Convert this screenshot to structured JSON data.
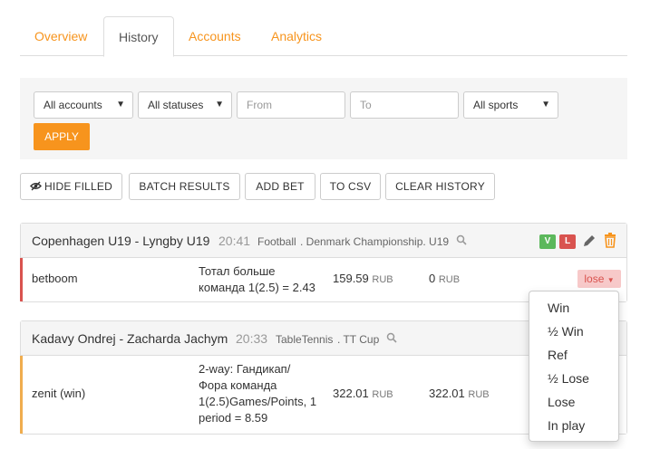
{
  "tabs": [
    {
      "label": "Overview"
    },
    {
      "label": "History"
    },
    {
      "label": "Accounts"
    },
    {
      "label": "Analytics"
    }
  ],
  "filters": {
    "accounts": "All accounts",
    "statuses": "All statuses",
    "from_placeholder": "From",
    "to_placeholder": "To",
    "sports": "All sports",
    "apply_label": "APPLY"
  },
  "toolbar": {
    "hide_filled": "HIDE FILLED",
    "batch_results": "BATCH RESULTS",
    "add_bet": "ADD BET",
    "to_csv": "TO CSV",
    "clear_history": "CLEAR HISTORY"
  },
  "bets": [
    {
      "match": "Copenhagen U19 - Lyngby U19",
      "time": "20:41",
      "sport": "Football",
      "league": ". Denmark Championship. U19",
      "badges": [
        "V",
        "L"
      ],
      "account": "betboom",
      "market_line1": "Тотал больше",
      "market_line2": "команда 1(2.5) = 2.43",
      "stake": "159.59",
      "stake_currency": "RUB",
      "payout": "0",
      "payout_currency": "RUB",
      "status": "lose",
      "row_color": "#d9534f"
    },
    {
      "match": "Kadavy Ondrej - Zacharda Jachym",
      "time": "20:33",
      "sport": "TableTennis",
      "league": ". TT Cup",
      "account": "zenit (win)",
      "market_line1": "2-way: Гандикап/",
      "market_line2": "Фора команда",
      "market_line3": "1(2.5)Games/Points, 1",
      "market_line4": "period = 8.59",
      "stake": "322.01",
      "stake_currency": "RUB",
      "payout": "322.01",
      "payout_currency": "RUB",
      "row_color": "#f0ad4e"
    }
  ],
  "status_menu": [
    "Win",
    "½ Win",
    "Ref",
    "½ Lose",
    "Lose",
    "In play"
  ],
  "colors": {
    "accent": "#f7941d",
    "badge_green": "#5cb85c",
    "badge_red": "#d9534f"
  }
}
